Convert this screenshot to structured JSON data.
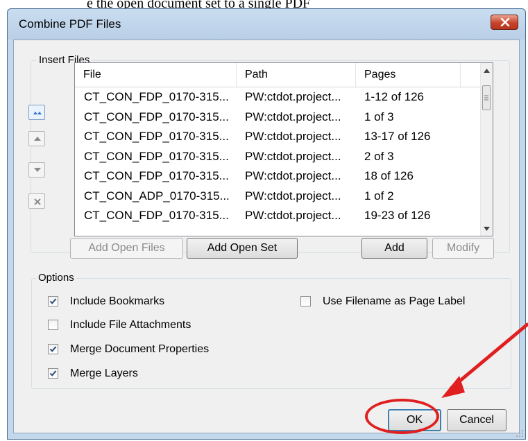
{
  "page_caption": "e the open document set to a single PDF",
  "dialog": {
    "title": "Combine PDF Files",
    "close_label": "close"
  },
  "insert_files": {
    "group_label": "Insert Files",
    "columns": [
      "File",
      "Path",
      "Pages"
    ],
    "rows": [
      {
        "file": "CT_CON_FDP_0170-315...",
        "path": "PW:ctdot.project...",
        "pages": "1-12 of 126"
      },
      {
        "file": "CT_CON_FDP_0170-315...",
        "path": "PW:ctdot.project...",
        "pages": "1 of 3"
      },
      {
        "file": "CT_CON_FDP_0170-315...",
        "path": "PW:ctdot.project...",
        "pages": "13-17 of 126"
      },
      {
        "file": "CT_CON_FDP_0170-315...",
        "path": "PW:ctdot.project...",
        "pages": "2 of 3"
      },
      {
        "file": "CT_CON_FDP_0170-315...",
        "path": "PW:ctdot.project...",
        "pages": "18 of 126"
      },
      {
        "file": "CT_CON_ADP_0170-315...",
        "path": "PW:ctdot.project...",
        "pages": "1 of 2"
      },
      {
        "file": "CT_CON_FDP_0170-315...",
        "path": "PW:ctdot.project...",
        "pages": "19-23 of 126"
      }
    ],
    "buttons": {
      "add_open_files": "Add Open Files",
      "add_open_set": "Add Open Set",
      "add": "Add",
      "modify": "Modify"
    }
  },
  "options": {
    "group_label": "Options",
    "include_bookmarks": {
      "label": "Include Bookmarks",
      "checked": true
    },
    "include_file_attachments": {
      "label": "Include File Attachments",
      "checked": false
    },
    "merge_document_properties": {
      "label": "Merge Document Properties",
      "checked": true
    },
    "merge_layers": {
      "label": "Merge Layers",
      "checked": true
    },
    "use_filename_as_page_label": {
      "label": "Use Filename as Page Label",
      "checked": false
    }
  },
  "footer": {
    "ok_label": "OK",
    "cancel_label": "Cancel"
  },
  "colors": {
    "annotation": "#e02020",
    "title_bar": "#c4d8ec",
    "close_button": "#c8432b"
  }
}
